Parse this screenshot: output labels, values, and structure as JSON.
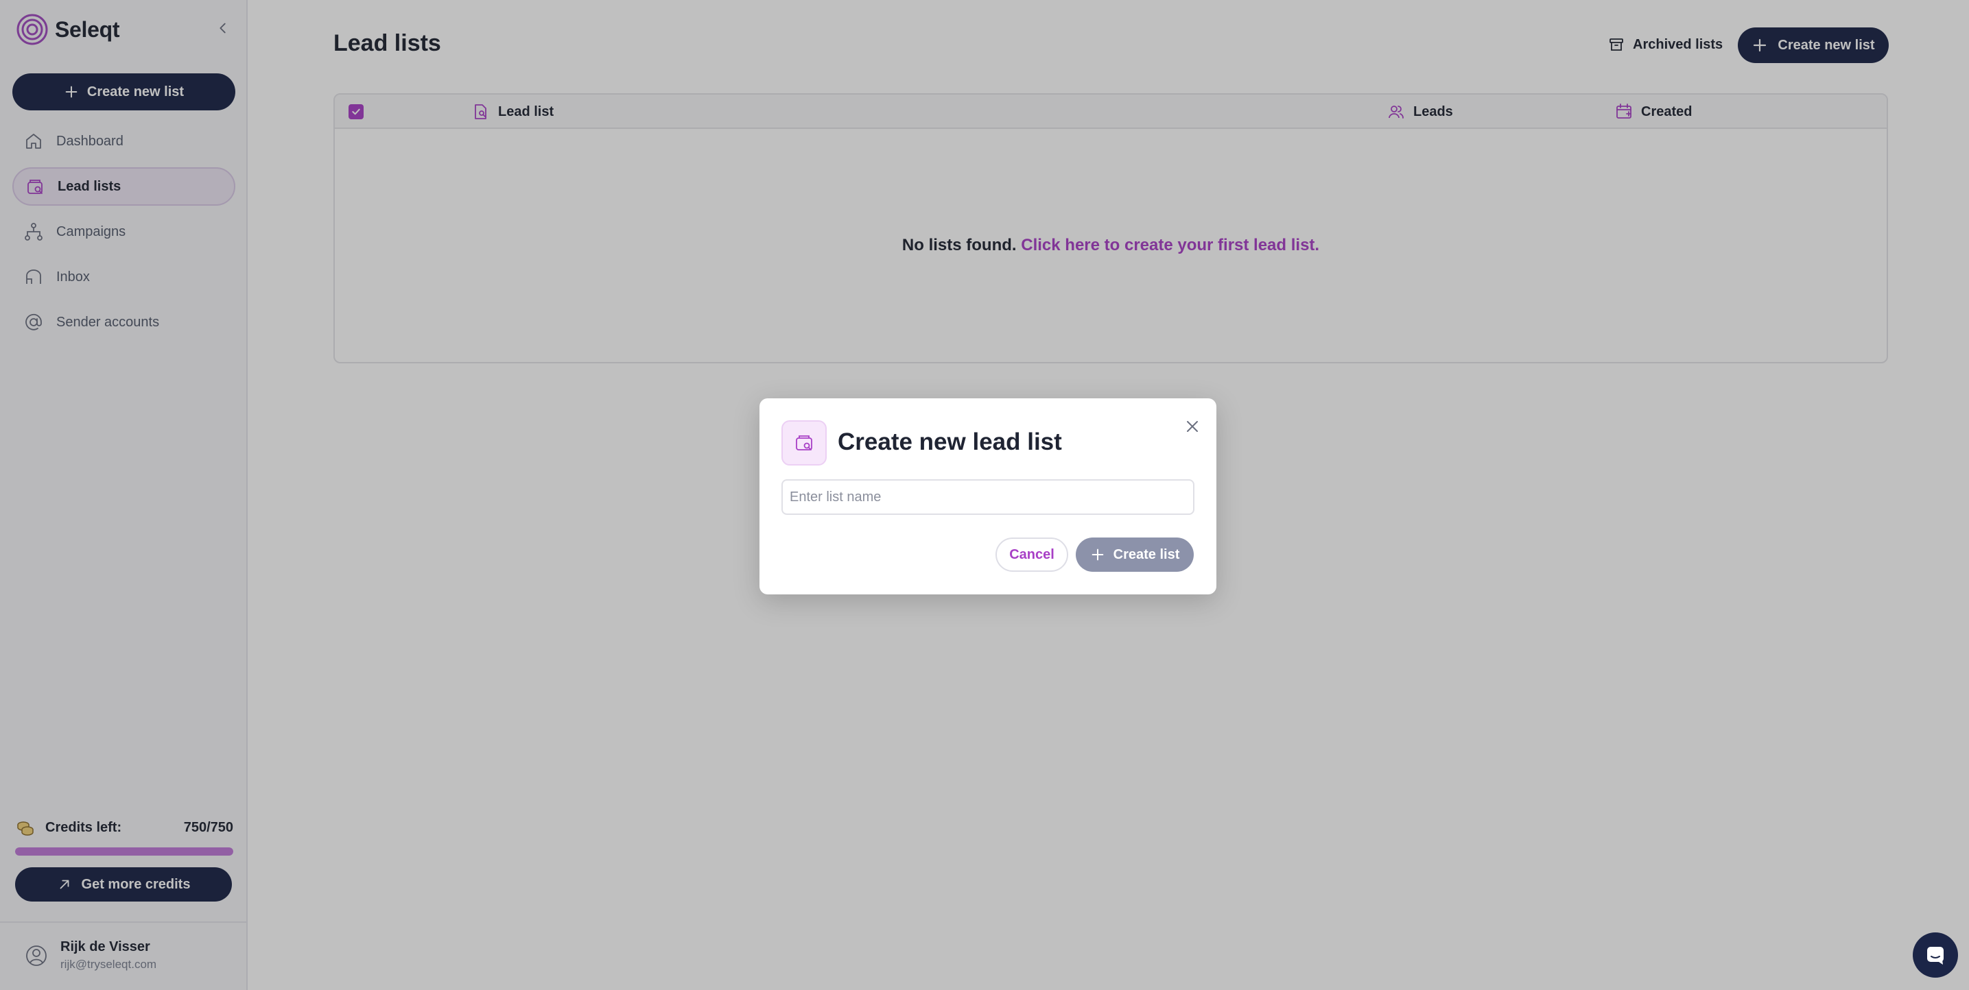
{
  "app": {
    "name": "Seleqt"
  },
  "sidebar": {
    "create_label": "Create new list",
    "items": [
      {
        "label": "Dashboard",
        "icon": "home-icon",
        "active": false
      },
      {
        "label": "Lead lists",
        "icon": "lead-list-icon",
        "active": true
      },
      {
        "label": "Campaigns",
        "icon": "campaigns-icon",
        "active": false
      },
      {
        "label": "Inbox",
        "icon": "inbox-icon",
        "active": false
      },
      {
        "label": "Sender accounts",
        "icon": "at-sign-icon",
        "active": false
      }
    ],
    "credits": {
      "label": "Credits left:",
      "value": "750/750",
      "fraction": 1.0
    },
    "more_credits_label": "Get more credits",
    "user": {
      "name": "Rijk de Visser",
      "email": "rijk@tryseleqt.com"
    }
  },
  "main": {
    "title": "Lead lists",
    "archived_label": "Archived lists",
    "create_label": "Create new list",
    "table": {
      "columns": {
        "lead_list": "Lead list",
        "leads": "Leads",
        "created": "Created"
      },
      "empty_text": "No lists found.",
      "empty_link": "Click here to create your first lead list."
    }
  },
  "modal": {
    "title": "Create new lead list",
    "input_placeholder": "Enter list name",
    "input_value": "",
    "cancel_label": "Cancel",
    "create_label": "Create list"
  },
  "colors": {
    "navy": "#1b2547",
    "accent": "#a83fc6",
    "disabled_button": "#8c92aa"
  }
}
